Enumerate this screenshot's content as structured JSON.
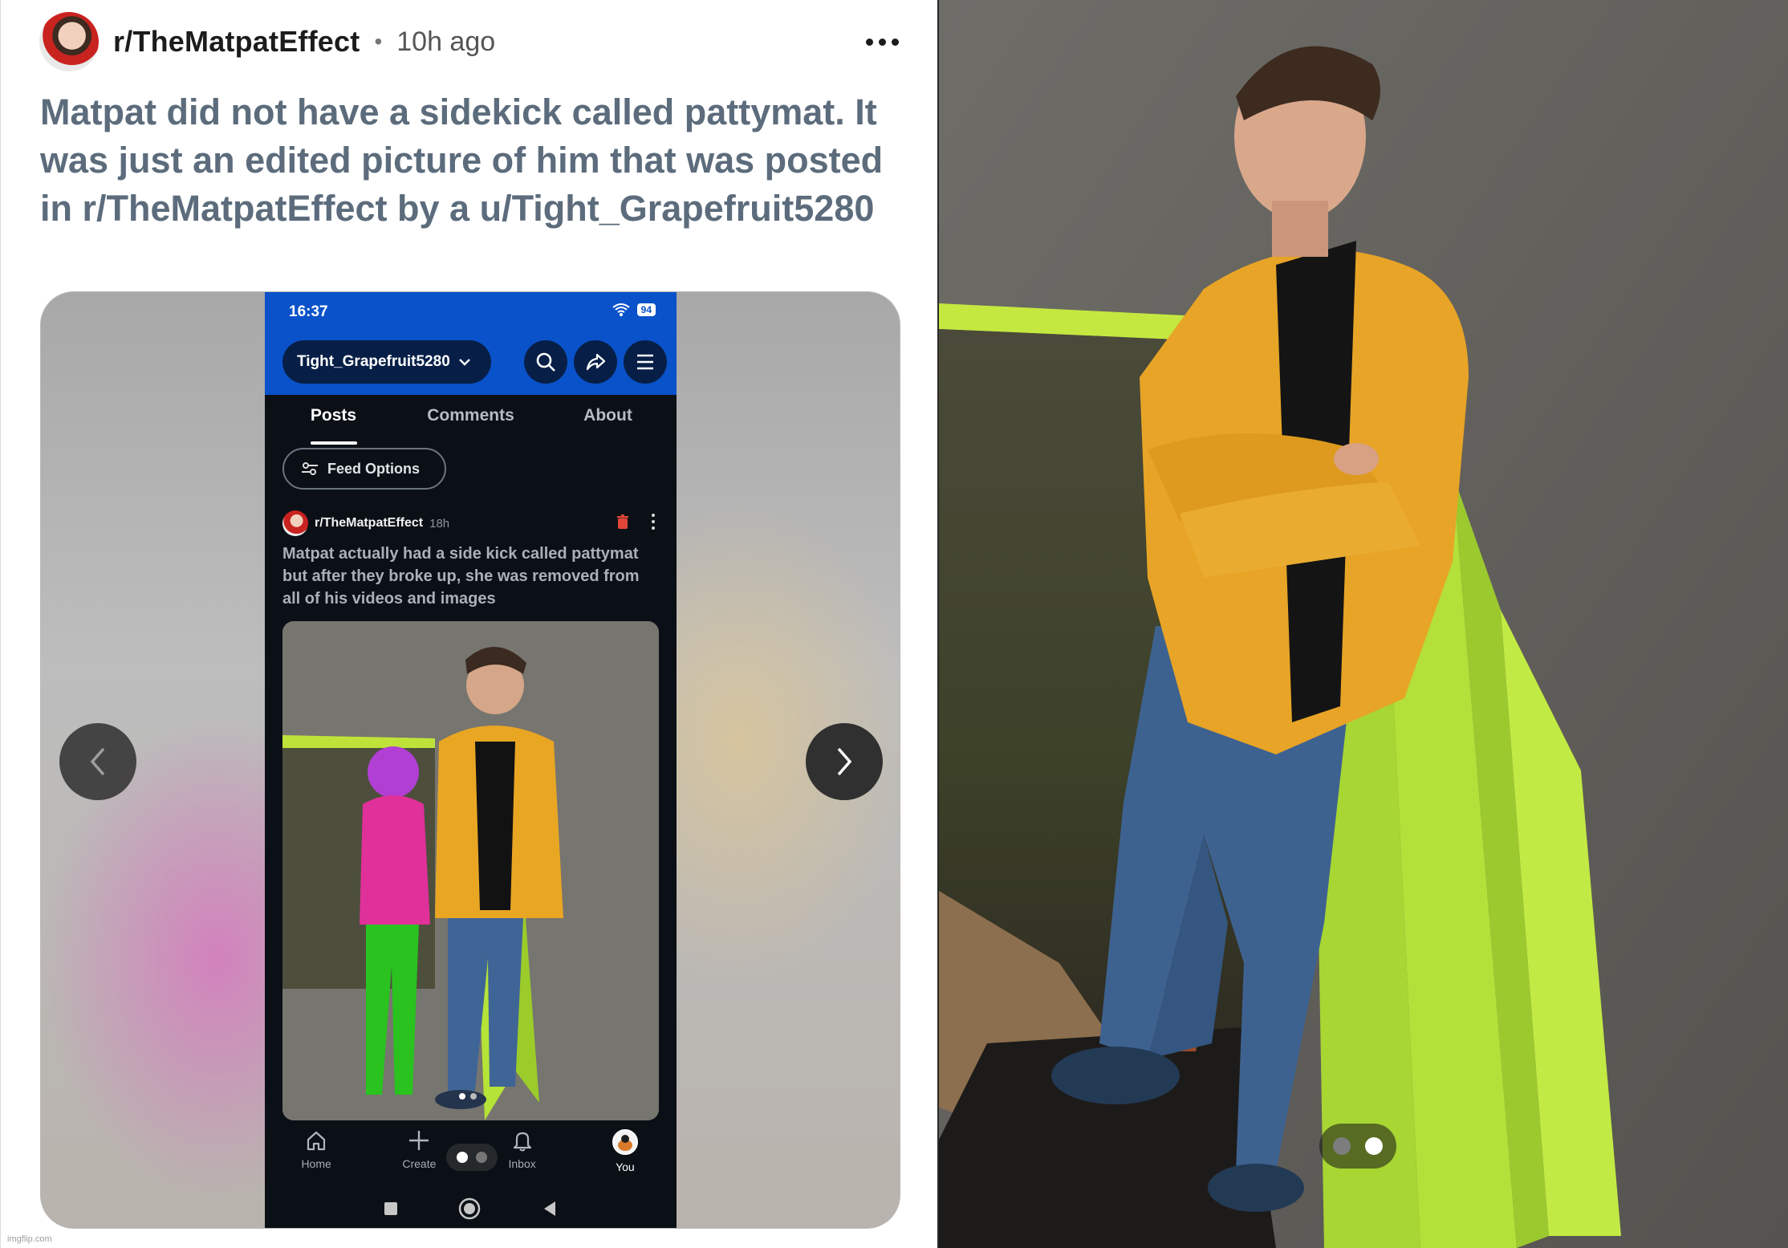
{
  "post": {
    "subreddit": "r/TheMatpatEffect",
    "separator": "•",
    "time": "10h ago",
    "title": "Matpat did not have a sidekick called pattymat. It was just an edited picture of him that was posted in r/TheMatpatEffect by a u/Tight_Grapefruit5280"
  },
  "phone": {
    "time": "16:37",
    "battery": "94",
    "username": "Tight_Grapefruit5280",
    "tabs": [
      {
        "label": "Posts"
      },
      {
        "label": "Comments"
      },
      {
        "label": "About"
      }
    ],
    "feed_options": "Feed Options",
    "inner_post": {
      "subreddit": "r/TheMatpatEffect",
      "time": "18h",
      "title": "Matpat actually had a side kick called pattymat but after they broke up, she was removed from all of his videos and images"
    },
    "bottom_nav": [
      {
        "label": "Home",
        "icon": "home-icon"
      },
      {
        "label": "Create",
        "icon": "plus-icon"
      },
      {
        "label": "Inbox",
        "icon": "bell-icon"
      },
      {
        "label": "You",
        "icon": "avatar-icon"
      }
    ]
  },
  "carousel": {
    "current_slide": 1,
    "total_slides": 2
  },
  "photo": {
    "current_slide": 2,
    "total_slides": 2
  },
  "watermark": "imgflip.com",
  "colors": {
    "title_text": "#5c6c7c",
    "phone_header": "#0a52c9",
    "jacket_yellow": "#e9a623",
    "dumpster_green": "#b8e43a"
  }
}
